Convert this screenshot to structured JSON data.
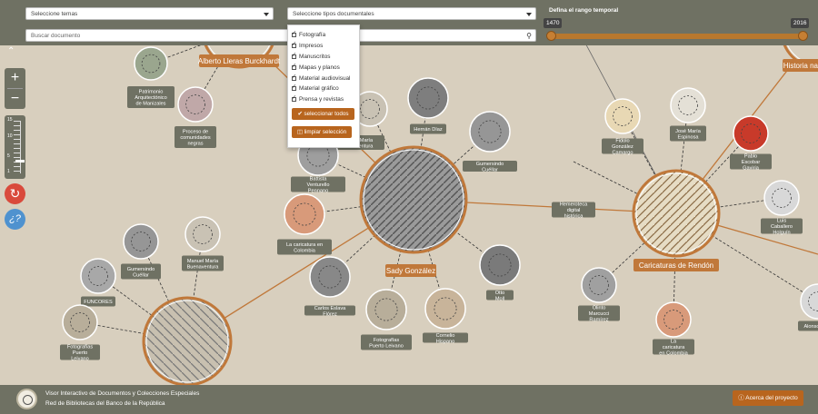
{
  "filters": {
    "themes_placeholder": "Seleccione temas",
    "doc_types_placeholder": "Seleccione tipos documentales",
    "search_placeholder": "Buscar documento"
  },
  "range": {
    "title": "Defina el rango temporal",
    "min_label": "1470",
    "max_label": "2016",
    "start_fraction": 0,
    "end_fraction": 1
  },
  "dropdown": {
    "options": [
      "Fotografía",
      "Impresos",
      "Manuscritos",
      "Mapas y planos",
      "Material audiovisual",
      "Material gráfico",
      "Prensa y revistas"
    ],
    "select_all": "seleccionar todos",
    "clear_selection": "limpiar selección"
  },
  "controls": {
    "zoom_in": "+",
    "zoom_out": "−",
    "scale_max": "15",
    "scale_min": "1",
    "scale_marks": [
      "10",
      "5"
    ],
    "reset_icon": "refresh-icon",
    "help_icon": "help-icon"
  },
  "graph": {
    "hubs": [
      {
        "id": "sady",
        "label": "Sady González"
      },
      {
        "id": "rendon",
        "label": "Caricaturas de Rendón"
      },
      {
        "id": "alberto",
        "label": "Alberto Lleras Burckhardt"
      },
      {
        "id": "historia",
        "label": "Historia nat"
      },
      {
        "id": "bottom",
        "label": ""
      }
    ],
    "nodes": [
      {
        "label": "Patrimonio Arquitectónico de Manizales",
        "color": "#9aa68e"
      },
      {
        "label": "Proceso de comunidades negras",
        "color": "#c0a8a8"
      },
      {
        "label": "Manuel María Buenaventura",
        "color": "#c9c2b4"
      },
      {
        "label": "Hernán Díaz",
        "color": "#7e7e7e"
      },
      {
        "label": "Gumersindo Cuéllar",
        "color": "#969696"
      },
      {
        "label": "Battista Venturello Pennano",
        "color": "#9e9e9e"
      },
      {
        "label": "La caricatura en Colombia",
        "color": "#d89a7a"
      },
      {
        "label": "Carlos Eslava Flórez",
        "color": "#888888"
      },
      {
        "label": "Fotografías Puerto Leivano",
        "color": "#b8ae9a"
      },
      {
        "label": "Cornelio Hispano",
        "color": "#c8b49a"
      },
      {
        "label": "Otto Moll",
        "color": "#7a7a7a"
      },
      {
        "label": "Hemeroteca digital histórica",
        "color": "#d8cfbe"
      },
      {
        "label": "Fidolo González Camargo",
        "color": "#e8d8b4"
      },
      {
        "label": "José María Espinosa",
        "color": "#e4e0d6"
      },
      {
        "label": "Pablo Escobar Gaviria",
        "color": "#c83a2a"
      },
      {
        "label": "Luis Caballero Holguín",
        "color": "#d8d8d8"
      },
      {
        "label": "Olinto Marcucci Ramírez",
        "color": "#a0a0a0"
      },
      {
        "label": "La caricatura en Colombia",
        "color": "#d89a7a"
      },
      {
        "label": "Alonso",
        "color": "#d8d8d8"
      },
      {
        "label": "Gumersindo Cuéllar",
        "color": "#969696"
      },
      {
        "label": "Manuel María Buenaventura",
        "color": "#c9c2b4"
      },
      {
        "label": "FUNCORES",
        "color": "#a8a8a8"
      },
      {
        "label": "Fotografías Puerto Leivano",
        "color": "#b8ae9a"
      }
    ]
  },
  "footer": {
    "line1": "Visor Interactivo de Documentos y Colecciones Especiales",
    "line2": "Red de Bibliotecas del Banco de la República",
    "about_button": "Acerca del proyecto",
    "about_icon": "info-icon"
  }
}
